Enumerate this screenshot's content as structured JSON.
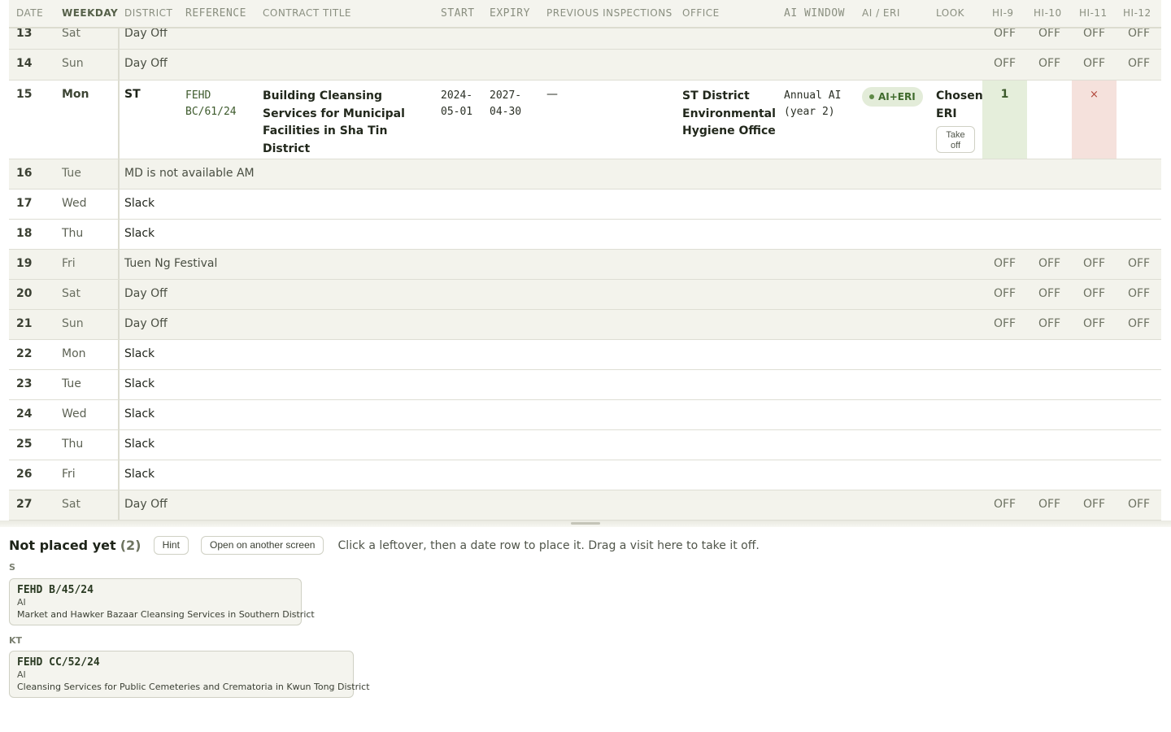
{
  "header": {
    "date": "DATE",
    "weekday": "WEEKDAY",
    "district": "DISTRICT",
    "reference": "REFERENCE",
    "contract_title": "CONTRACT TITLE",
    "start": "START",
    "expiry": "EXPIRY",
    "previous_inspections": "PREVIOUS INSPECTIONS",
    "office": "OFFICE",
    "ai_window": "AI WINDOW",
    "ai_eri": "AI / ERI",
    "look": "LOOK",
    "hi9": "HI-9",
    "hi10": "HI-10",
    "hi11": "HI-11",
    "hi12": "HI-12"
  },
  "off_label": "OFF",
  "rows": [
    {
      "date": "13",
      "weekday": "Sat",
      "note": "Day Off"
    },
    {
      "date": "14",
      "weekday": "Sun",
      "note": "Day Off"
    },
    {
      "date": "16",
      "weekday": "Tue",
      "note": "MD is not available AM"
    },
    {
      "date": "17",
      "weekday": "Wed",
      "note": "Slack"
    },
    {
      "date": "18",
      "weekday": "Thu",
      "note": "Slack"
    },
    {
      "date": "19",
      "weekday": "Fri",
      "note": "Tuen Ng Festival"
    },
    {
      "date": "20",
      "weekday": "Sat",
      "note": "Day Off"
    },
    {
      "date": "21",
      "weekday": "Sun",
      "note": "Day Off"
    },
    {
      "date": "22",
      "weekday": "Mon",
      "note": "Slack"
    },
    {
      "date": "23",
      "weekday": "Tue",
      "note": "Slack"
    },
    {
      "date": "24",
      "weekday": "Wed",
      "note": "Slack"
    },
    {
      "date": "25",
      "weekday": "Thu",
      "note": "Slack"
    },
    {
      "date": "26",
      "weekday": "Fri",
      "note": "Slack"
    },
    {
      "date": "27",
      "weekday": "Sat",
      "note": "Day Off"
    }
  ],
  "detail": {
    "date": "15",
    "weekday": "Mon",
    "district": "ST",
    "reference": "FEHD BC/61/24",
    "contract_title": "Building Cleansing Services for Municipal Facilities in Sha Tin District",
    "start": "2024-05-01",
    "expiry": "2027-04-30",
    "previous_inspections": "—",
    "office": "ST District Environmental Hygiene Office",
    "ai_window": "Annual AI (year 2)",
    "ai_eri": "AI+ERI",
    "look": "Chosen ERI",
    "take_off_label": "Take off",
    "hi9_value": "1",
    "hi11_value": "×"
  },
  "tray": {
    "title": "Not placed yet",
    "count": "(2)",
    "hint_button": "Hint",
    "open_button": "Open on another screen",
    "instructions": "Click a leftover, then a date row to place it. Drag a visit here to take it off.",
    "groups": [
      {
        "district": "S",
        "reference": "FEHD B/45/24",
        "type": "AI",
        "title": "Market and Hawker Bazaar Cleansing Services in Southern District"
      },
      {
        "district": "KT",
        "reference": "FEHD CC/52/24",
        "type": "AI",
        "title": "Cleansing Services for Public Cemeteries and Crematoria in Kwun Tong District"
      }
    ]
  }
}
